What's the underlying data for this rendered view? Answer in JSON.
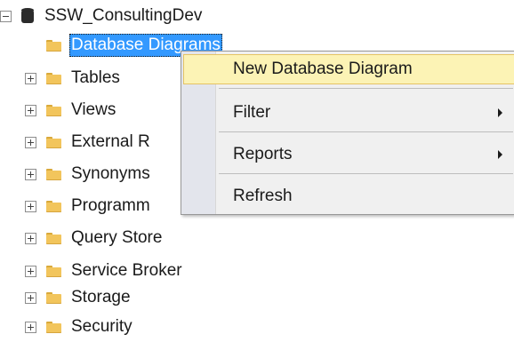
{
  "tree": {
    "root": {
      "label": "SSW_ConsultingDev",
      "icon": "database-icon",
      "expanded": true
    },
    "children": [
      {
        "label": "Database Diagrams",
        "icon": "folder-icon",
        "expandable": false,
        "selected": true
      },
      {
        "label": "Tables",
        "icon": "folder-icon",
        "expandable": true
      },
      {
        "label": "Views",
        "icon": "folder-icon",
        "expandable": true
      },
      {
        "label": "External R",
        "icon": "folder-icon",
        "expandable": true
      },
      {
        "label": "Synonyms",
        "icon": "folder-icon",
        "expandable": true
      },
      {
        "label": "Programm",
        "icon": "folder-icon",
        "expandable": true
      },
      {
        "label": "Query Store",
        "icon": "folder-icon",
        "expandable": true
      },
      {
        "label": "Service Broker",
        "icon": "folder-icon",
        "expandable": true
      },
      {
        "label": "Storage",
        "icon": "folder-icon",
        "expandable": true
      },
      {
        "label": "Security",
        "icon": "folder-icon",
        "expandable": true
      }
    ]
  },
  "context_menu": {
    "items": [
      {
        "label": "New Database Diagram",
        "highlighted": true,
        "submenu": false
      },
      {
        "label": "Filter",
        "submenu": true
      },
      {
        "label": "Reports",
        "submenu": true
      },
      {
        "label": "Refresh",
        "submenu": false
      }
    ]
  },
  "colors": {
    "selection": "#3399ff",
    "menu_highlight": "#fcf3b5",
    "menu_background": "#f0f0f0",
    "folder": "#f2c55c"
  }
}
